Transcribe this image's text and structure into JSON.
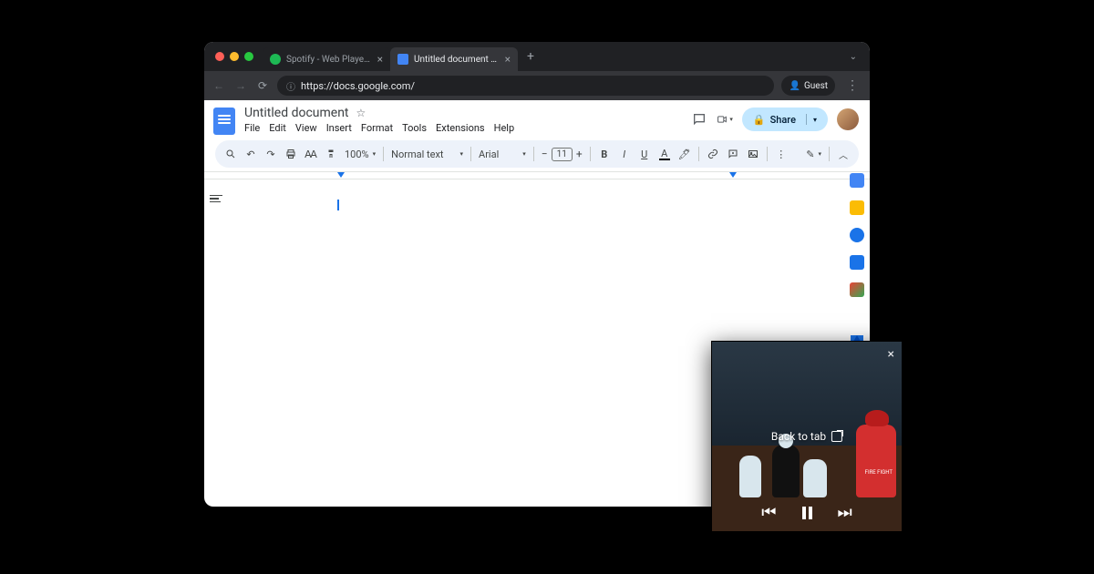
{
  "browser": {
    "tabs": [
      {
        "label": "Spotify - Web Player: Music f",
        "favicon": "spotify"
      },
      {
        "label": "Untitled document - Google D",
        "favicon": "docs"
      }
    ],
    "url": "https://docs.google.com/",
    "guest_label": "Guest"
  },
  "docs": {
    "title": "Untitled document",
    "menus": [
      "File",
      "Edit",
      "View",
      "Insert",
      "Format",
      "Tools",
      "Extensions",
      "Help"
    ],
    "share_label": "Share",
    "toolbar": {
      "zoom": "100%",
      "style": "Normal text",
      "font": "Arial",
      "font_size": "11"
    }
  },
  "pip": {
    "back_label": "Back to tab",
    "fire_label": "FIRE\nFIGHT"
  }
}
